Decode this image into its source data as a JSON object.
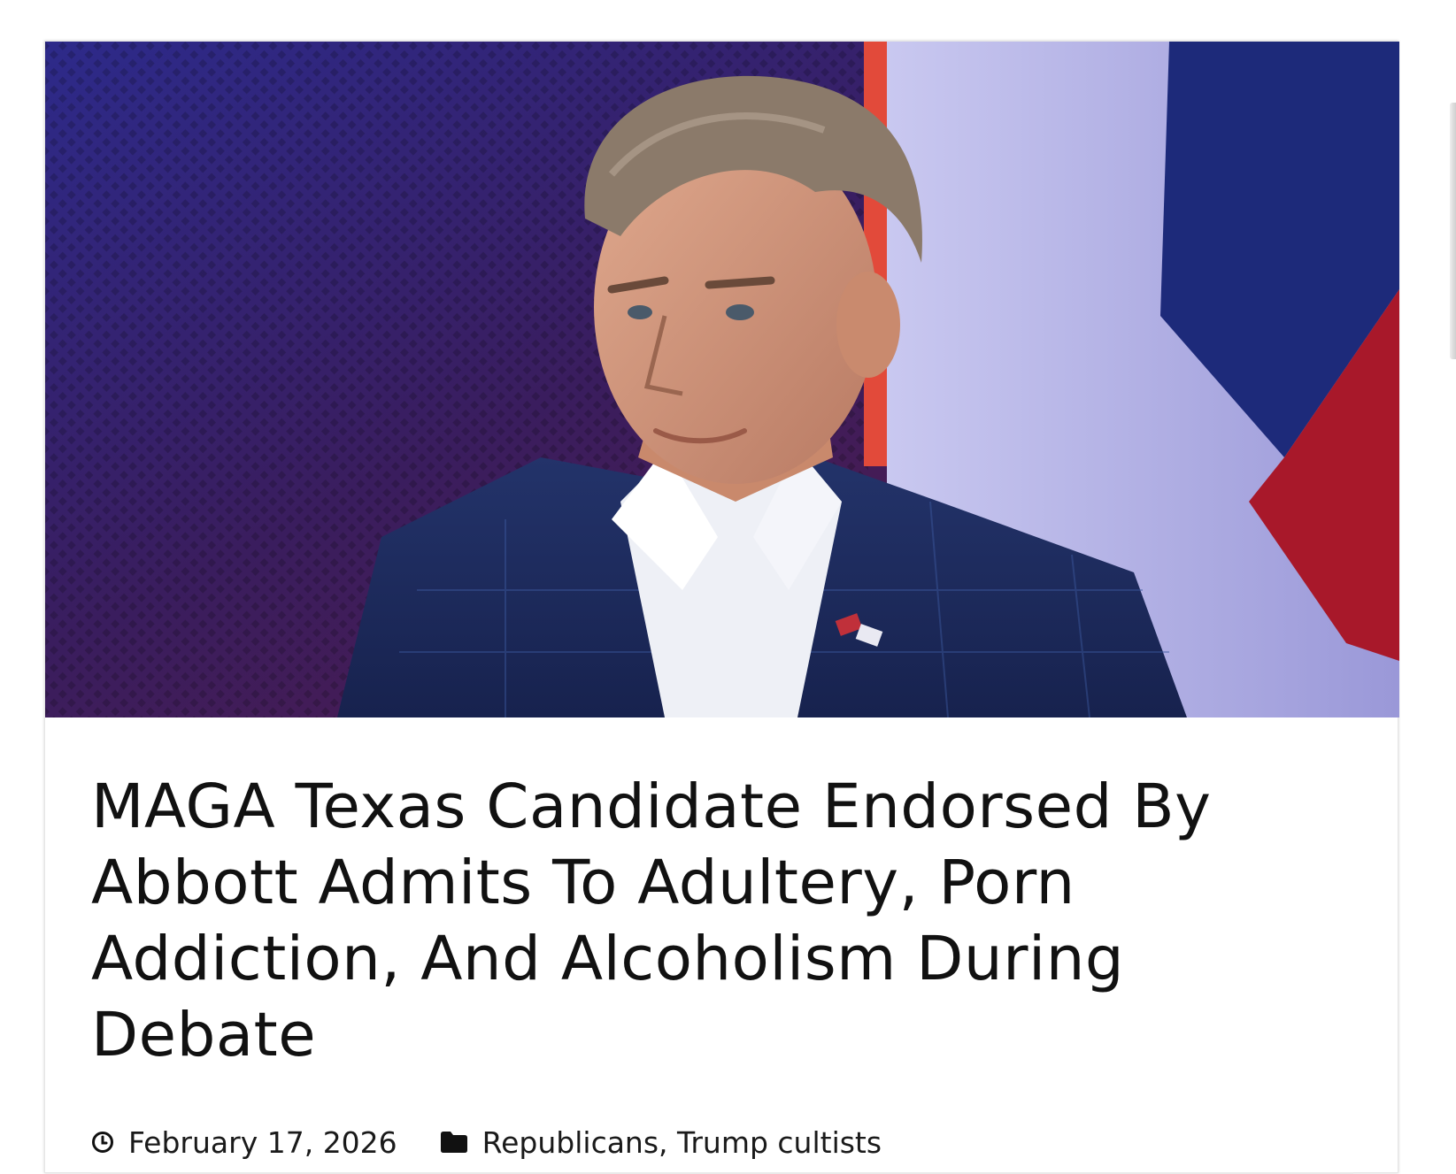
{
  "article": {
    "image_alt": "Man in navy plaid blazer and white shirt with flag lapel pin, in front of a Texas flag backdrop",
    "title": "MAGA Texas Candidate Endorsed By Abbott Admits To Adultery, Porn Addiction, And Alcoholism During Debate",
    "meta": {
      "date_icon": "clock-icon",
      "date": "February 17, 2026",
      "category_icon": "folder-icon",
      "categories": [
        "Republicans",
        "Trump cultists"
      ],
      "category_separator": ", "
    }
  },
  "colors": {
    "background": "#ffffff",
    "text": "#111111",
    "divider": "#e9e9e9"
  }
}
